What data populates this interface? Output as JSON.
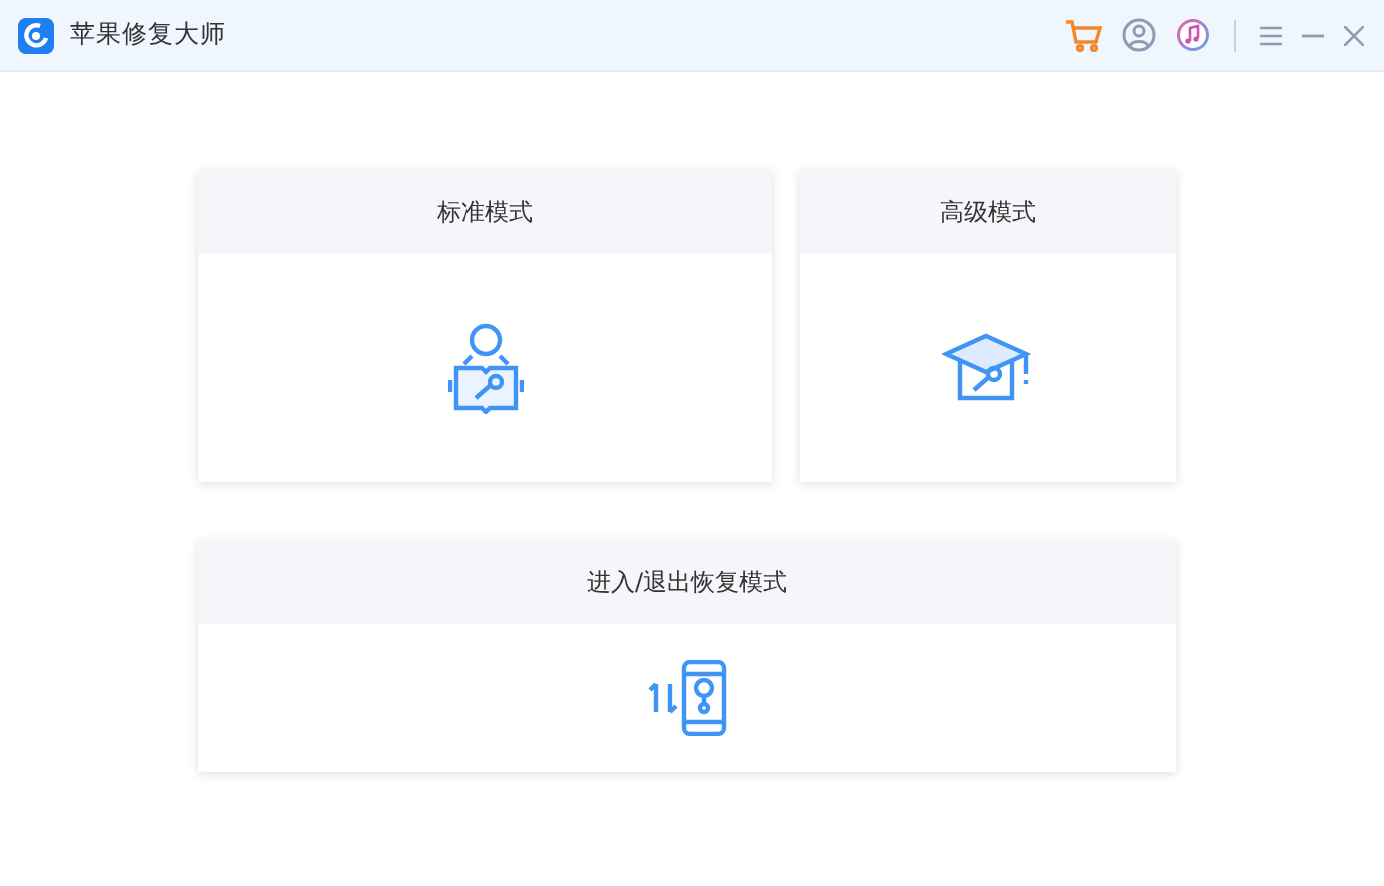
{
  "window": {
    "title": "苹果修复大师"
  },
  "modes": [
    {
      "label": "标准模式",
      "kind": "standard"
    },
    {
      "label": "高级模式",
      "kind": "advanced"
    },
    {
      "label": "进入/退出恢复模式",
      "kind": "recovery"
    }
  ]
}
